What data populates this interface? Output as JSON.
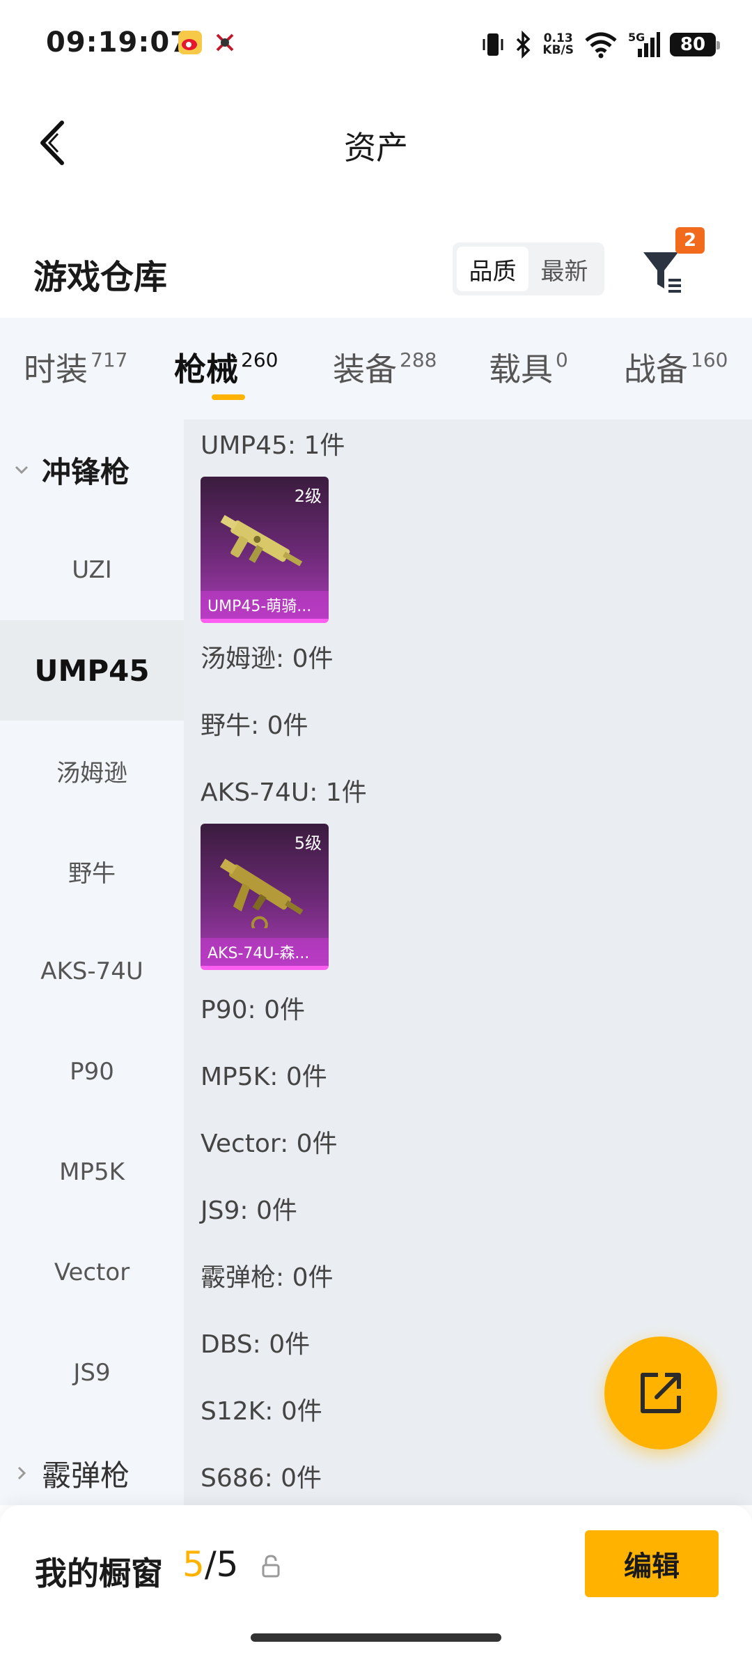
{
  "status_bar": {
    "time": "09:19:07",
    "net_speed_value": "0.13",
    "net_speed_unit": "KB/S",
    "network": "5G",
    "battery": "80"
  },
  "nav": {
    "title": "资产"
  },
  "section": {
    "title": "游戏仓库",
    "sort_options": [
      "品质",
      "最新"
    ],
    "sort_active": "品质",
    "filter_count": "2"
  },
  "tabs": [
    {
      "label": "时装",
      "count": "717"
    },
    {
      "label": "枪械",
      "count": "260"
    },
    {
      "label": "装备",
      "count": "288"
    },
    {
      "label": "载具",
      "count": "0"
    },
    {
      "label": "战备",
      "count": "160"
    }
  ],
  "sidebar": {
    "group_open": "冲锋枪",
    "items": [
      "UZI",
      "UMP45",
      "汤姆逊",
      "野牛",
      "AKS-74U",
      "P90",
      "MP5K",
      "Vector",
      "JS9"
    ],
    "selected": "UMP45",
    "group_collapsed": "霰弹枪"
  },
  "content": {
    "rows": [
      "UMP45: 1件",
      "汤姆逊: 0件",
      "野牛: 0件",
      "AKS-74U: 1件",
      "P90: 0件",
      "MP5K: 0件",
      "Vector: 0件",
      "JS9: 0件",
      "霰弹枪: 0件",
      "DBS: 0件",
      "S12K: 0件",
      "S686: 0件"
    ],
    "cards": [
      {
        "level": "2级",
        "name": "UMP45-萌骑..."
      },
      {
        "level": "5级",
        "name": "AKS-74U-森..."
      }
    ]
  },
  "bottom": {
    "label": "我的橱窗",
    "current": "5",
    "total": "/5",
    "edit_label": "编辑"
  },
  "colors": {
    "accent": "#ffb300",
    "badge": "#f26b1d",
    "card_purple": "#a73cb4"
  }
}
